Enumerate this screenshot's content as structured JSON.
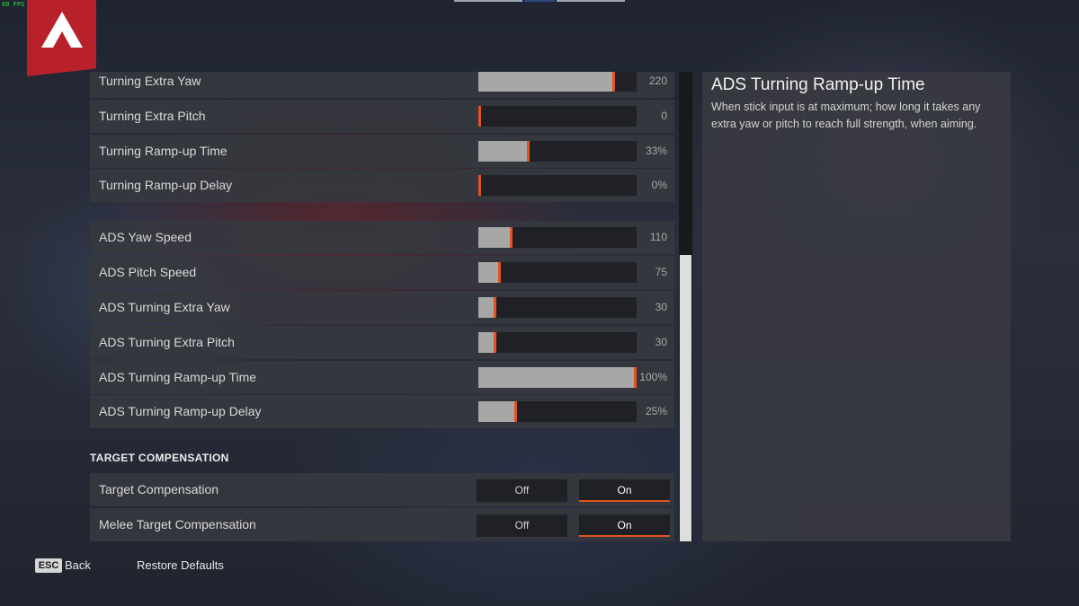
{
  "fps_counter": "60 FPS",
  "colors": {
    "accent": "#e2531f",
    "logo_red": "#b8202a",
    "slider_fill": "#a7a7a7"
  },
  "logo": {
    "icon": "apex-logo-icon"
  },
  "sliders": [
    {
      "label": "Turning Extra Yaw",
      "value": "220",
      "fill": 0.86
    },
    {
      "label": "Turning Extra Pitch",
      "value": "0",
      "fill": 0.0
    },
    {
      "label": "Turning Ramp-up Time",
      "value": "33%",
      "fill": 0.31
    },
    {
      "label": "Turning Ramp-up Delay",
      "value": "0%",
      "fill": 0.0
    },
    {
      "label": "ADS Yaw Speed",
      "value": "110",
      "fill": 0.2
    },
    {
      "label": "ADS Pitch Speed",
      "value": "75",
      "fill": 0.13
    },
    {
      "label": "ADS Turning Extra Yaw",
      "value": "30",
      "fill": 0.1
    },
    {
      "label": "ADS Turning Extra Pitch",
      "value": "30",
      "fill": 0.1
    },
    {
      "label": "ADS Turning Ramp-up Time",
      "value": "100%",
      "fill": 1.0
    },
    {
      "label": "ADS Turning Ramp-up Delay",
      "value": "25%",
      "fill": 0.23
    }
  ],
  "section": {
    "title": "TARGET COMPENSATION"
  },
  "toggles": [
    {
      "label": "Target Compensation",
      "off_label": "Off",
      "on_label": "On",
      "selected": "On"
    },
    {
      "label": "Melee Target Compensation",
      "off_label": "Off",
      "on_label": "On",
      "selected": "On"
    }
  ],
  "description": {
    "title": "ADS Turning Ramp-up Time",
    "text": "When stick input is at maximum; how long it takes any extra yaw or pitch to reach full strength, when aiming."
  },
  "footer": {
    "esc_key": "ESC",
    "back_label": "Back",
    "restore_label": "Restore Defaults"
  }
}
